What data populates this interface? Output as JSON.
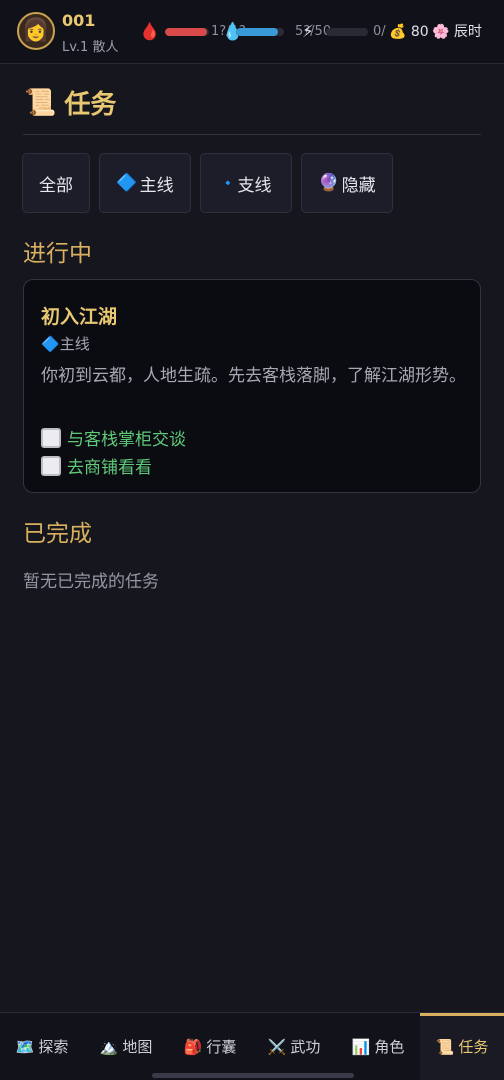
{
  "player": {
    "avatar_icon": "👩",
    "name": "001",
    "level_text": "Lv.1 散人"
  },
  "stats": {
    "hp": {
      "icon": "🩸",
      "text": "1▒/1▒▒",
      "display": "1?/1?",
      "fill": 0.95,
      "color": "#d84a4a"
    },
    "mp": {
      "icon": "💧",
      "display": "5?/50",
      "fill": 0.88,
      "color": "#3a9ad8"
    },
    "energy": {
      "icon": "⚡",
      "display": "0/",
      "fill": 0.0,
      "color": "#e8b830"
    },
    "money": {
      "icon": "💰",
      "value": "80"
    },
    "time": {
      "icon": "🌸",
      "value": "辰时"
    }
  },
  "page": {
    "title_icon": "📜",
    "title": "任务"
  },
  "filters": [
    {
      "label": "全部",
      "icon": ""
    },
    {
      "label": "主线",
      "icon": "🔷"
    },
    {
      "label": "支线",
      "icon": "🔹"
    },
    {
      "label": "隐藏",
      "icon": "🔮"
    }
  ],
  "sections": {
    "in_progress": "进行中",
    "completed": "已完成",
    "completed_empty": "暂无已完成的任务"
  },
  "quests": [
    {
      "name": "初入江湖",
      "type_icon": "🔷",
      "type": "主线",
      "description": "你初到云都，人地生疏。先去客栈落脚，了解江湖形势。",
      "objectives": [
        "与客栈掌柜交谈",
        "去商铺看看"
      ]
    }
  ],
  "nav": [
    {
      "icon": "🗺️",
      "label": "探索"
    },
    {
      "icon": "🏔️",
      "label": "地图"
    },
    {
      "icon": "🎒",
      "label": "行囊"
    },
    {
      "icon": "⚔️",
      "label": "武功"
    },
    {
      "icon": "📊",
      "label": "角色"
    },
    {
      "icon": "📜",
      "label": "任务",
      "active": true
    }
  ]
}
